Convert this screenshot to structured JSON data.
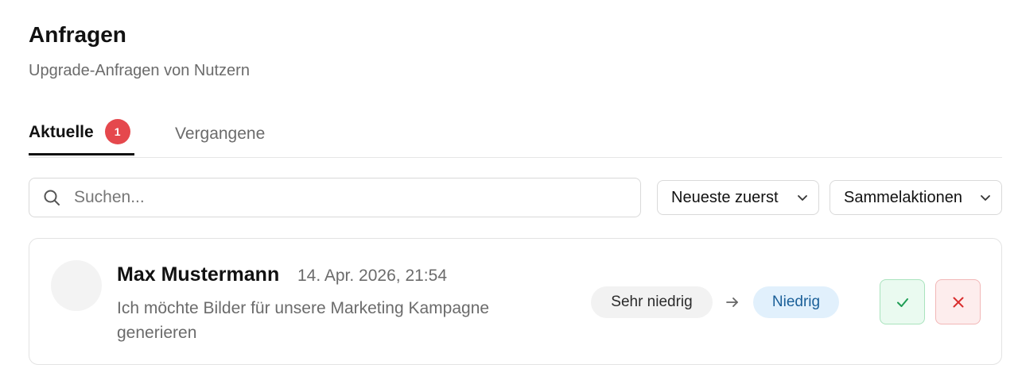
{
  "header": {
    "title": "Anfragen",
    "subtitle": "Upgrade-Anfragen von Nutzern"
  },
  "tabs": [
    {
      "label": "Aktuelle",
      "badge": "1",
      "active": true
    },
    {
      "label": "Vergangene",
      "active": false
    }
  ],
  "search": {
    "placeholder": "Suchen...",
    "value": "",
    "icon": "search-icon"
  },
  "sort_dropdown": {
    "label": "Neueste zuerst",
    "icon": "chevron-down-icon"
  },
  "bulk_dropdown": {
    "label": "Sammelaktionen",
    "icon": "chevron-down-icon"
  },
  "requests": [
    {
      "name": "Max Mustermann",
      "date": "14. Apr. 2026, 21:54",
      "message": "Ich möchte Bilder für unsere Marketing Kampagne generieren",
      "from_level": "Sehr niedrig",
      "to_level": "Niedrig",
      "approve_icon": "check-icon",
      "reject_icon": "close-icon"
    }
  ],
  "colors": {
    "badge": "#e5484d",
    "approve_bg": "#eafaf0",
    "approve_fg": "#1f9d55",
    "reject_bg": "#fdeded",
    "reject_fg": "#d92d2d",
    "target_pill_bg": "#e1f0fc",
    "target_pill_fg": "#1a5f98"
  }
}
